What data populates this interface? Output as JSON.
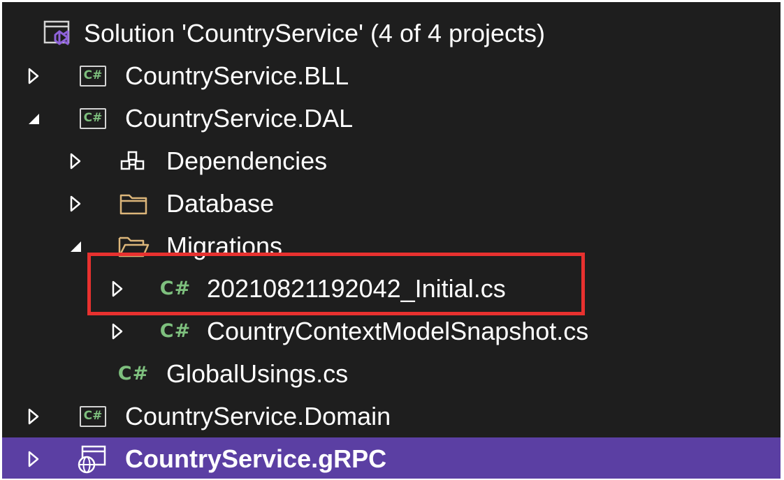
{
  "solution_explorer": {
    "rows": [
      {
        "text": "Solution 'CountryService' (4 of 4 projects)",
        "icon": "solution-icon",
        "expanded": true
      },
      {
        "text": "CountryService.BLL",
        "icon": "csharp-project-icon",
        "expanded": false
      },
      {
        "text": "CountryService.DAL",
        "icon": "csharp-project-icon",
        "expanded": true
      },
      {
        "text": "Dependencies",
        "icon": "dependencies-icon",
        "expanded": false
      },
      {
        "text": "Database",
        "icon": "folder-icon",
        "expanded": false
      },
      {
        "text": "Migrations",
        "icon": "folder-open-icon",
        "expanded": true
      },
      {
        "text": "20210821192042_Initial.cs",
        "icon": "csharp-file-icon",
        "expanded": false,
        "highlighted": true
      },
      {
        "text": "CountryContextModelSnapshot.cs",
        "icon": "csharp-file-icon",
        "expanded": false
      },
      {
        "text": "GlobalUsings.cs",
        "icon": "csharp-file-icon"
      },
      {
        "text": "CountryService.Domain",
        "icon": "csharp-project-icon",
        "expanded": false
      },
      {
        "text": "CountryService.gRPC",
        "icon": "web-project-icon",
        "expanded": false,
        "selected": true
      }
    ],
    "csharp_badge": "C#"
  },
  "colors": {
    "background": "#1e1e1e",
    "text": "#ffffff",
    "selection": "#5b3fa3",
    "csharp_green": "#7ec07e",
    "folder": "#dcb67a",
    "highlight_border": "#e8312f",
    "solution_purple": "#8e62d9"
  }
}
